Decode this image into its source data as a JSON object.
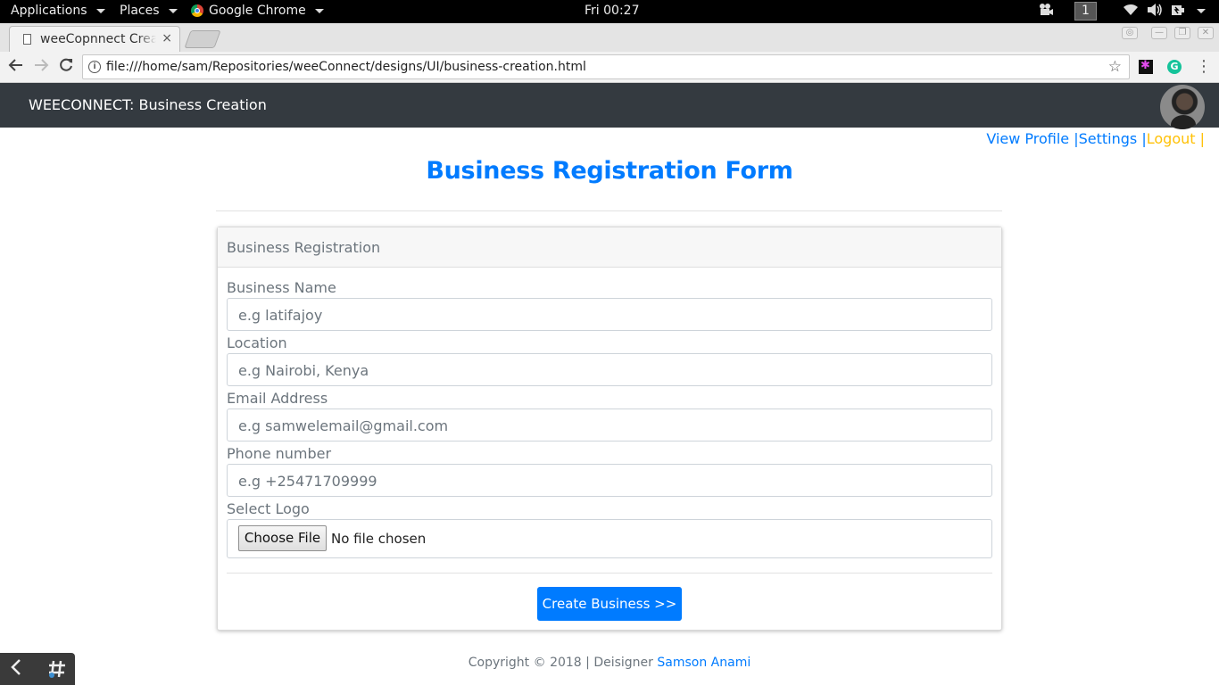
{
  "system_bar": {
    "applications": "Applications",
    "places": "Places",
    "active_app": "Google Chrome",
    "clock": "Fri 00:27",
    "workspace": "1"
  },
  "browser": {
    "tab_title": "weeCopnnect Creat",
    "tab_close": "×",
    "url": "file:///home/sam/Repositories/weeConnect/designs/UI/business-creation.html"
  },
  "navbar": {
    "brand": "WEECONNECT: Business Creation"
  },
  "user_links": {
    "view_profile": "View Profile",
    "sep1": " |",
    "settings": "Settings",
    "sep2": " |",
    "logout": "Logout |"
  },
  "page_title": "Business Registration Form",
  "form": {
    "header": "Business Registration",
    "fields": [
      {
        "label": "Business Name",
        "placeholder": "e.g latifajoy"
      },
      {
        "label": "Location",
        "placeholder": "e.g Nairobi, Kenya"
      },
      {
        "label": "Email Address",
        "placeholder": "e.g samwelemail@gmail.com"
      },
      {
        "label": "Phone number",
        "placeholder": "e.g +25471709999"
      }
    ],
    "logo_label": "Select Logo",
    "file_button": "Choose File",
    "file_status": "No file chosen",
    "submit": "Create Business >>"
  },
  "footer": {
    "text": "Copyright © 2018 | Deisigner ",
    "author": "Samson Anami"
  },
  "colors": {
    "primary": "#007bff",
    "warning": "#ffc107",
    "navbar_bg": "#343a40",
    "muted": "#6c757d"
  }
}
